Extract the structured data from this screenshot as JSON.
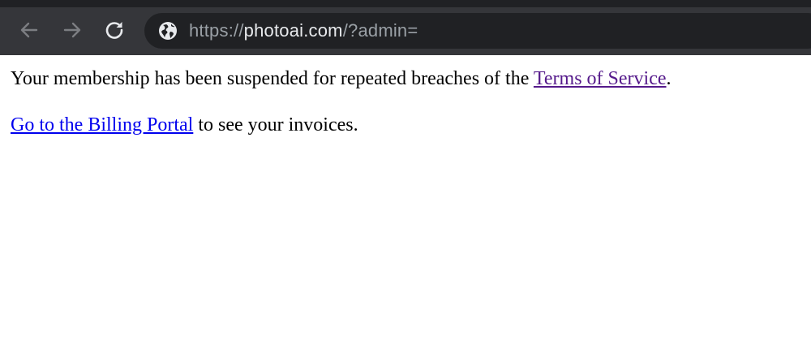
{
  "browser": {
    "address_bar": {
      "scheme": "https://",
      "host": "photoai.com",
      "path": "/?admin="
    },
    "icons": {
      "back": "back-arrow-icon",
      "forward": "forward-arrow-icon",
      "reload": "reload-icon",
      "site_info": "globe-icon"
    },
    "colors": {
      "toolbar": "#35363a",
      "omnibox": "#202124"
    }
  },
  "page": {
    "suspension_message": {
      "text": "Your membership has been suspended for repeated breaches of the ",
      "link_label": "Terms of Service",
      "suffix": "."
    },
    "billing_message": {
      "link_label": "Go to the Billing Portal",
      "text": " to see your invoices."
    },
    "colors": {
      "visited_link": "#551a8b",
      "link": "#0000ee"
    }
  }
}
